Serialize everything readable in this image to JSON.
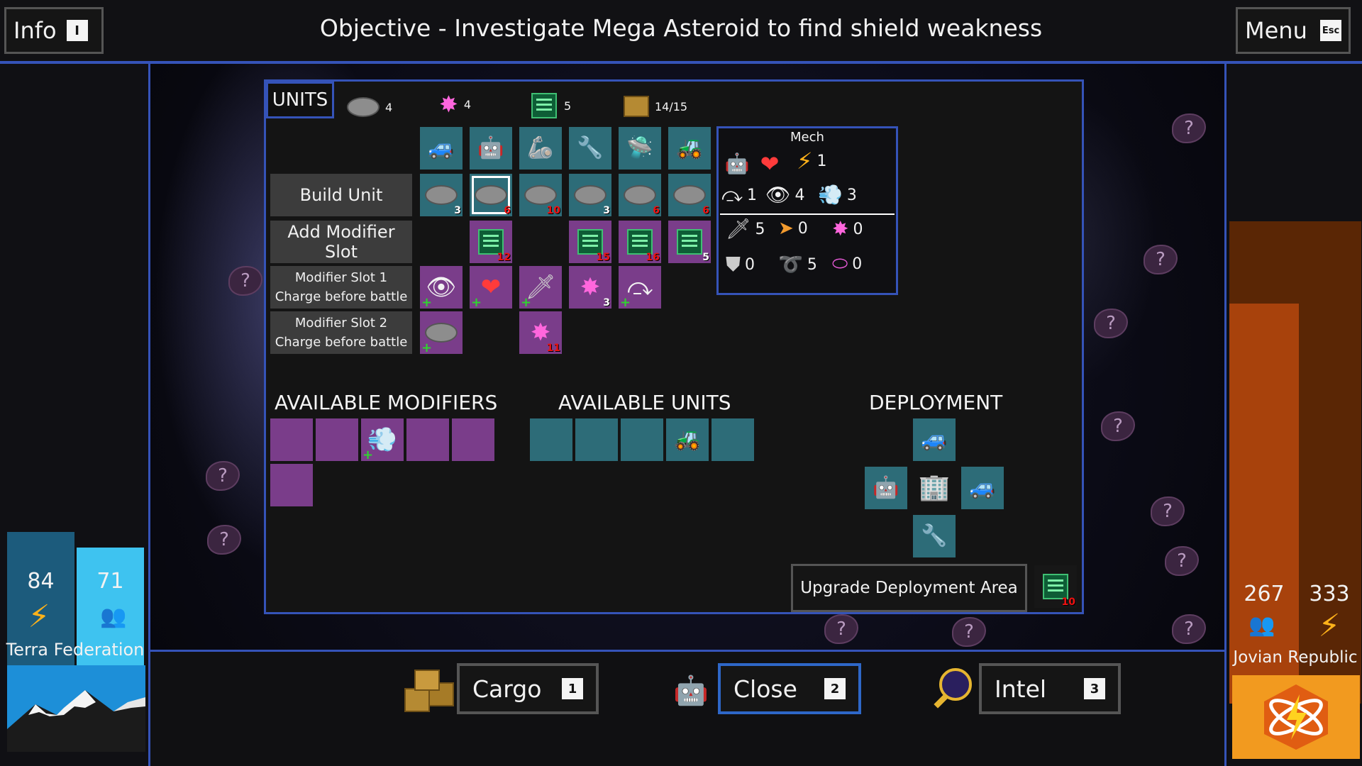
{
  "top": {
    "info_label": "Info",
    "info_key": "I",
    "objective_label": "Objective -",
    "objective_text": "Investigate Mega Asteroid to find shield weakness",
    "menu_label": "Menu",
    "menu_key": "Esc"
  },
  "left_faction": {
    "energy": "84",
    "population": "71",
    "name": "Terra Federation"
  },
  "right_faction": {
    "population": "267",
    "energy": "333",
    "name": "Jovian Republic"
  },
  "units_panel": {
    "tab_label": "UNITS",
    "resources": [
      {
        "icon": "rock-icon",
        "value": "4"
      },
      {
        "icon": "crystal-icon",
        "value": "4"
      },
      {
        "icon": "circuit-icon",
        "value": "5"
      },
      {
        "icon": "cargo-crate-icon",
        "value": "14/15"
      }
    ],
    "row_labels": {
      "build_unit": "Build Unit",
      "add_modifier_slot": "Add Modifier Slot",
      "modifier_slot_1_title": "Modifier Slot 1",
      "modifier_slot_1_sub": "Charge before battle",
      "modifier_slot_2_title": "Modifier Slot 2",
      "modifier_slot_2_sub": "Charge before battle"
    },
    "build_costs": [
      "3",
      "6",
      "10",
      "3",
      "6",
      "6"
    ],
    "slot_costs": [
      "12",
      "15",
      "16",
      "5"
    ],
    "slot1_cost": "3",
    "slot2_cost": "11",
    "headings": {
      "available_modifiers": "AVAILABLE MODIFIERS",
      "available_units": "AVAILABLE UNITS",
      "deployment": "DEPLOYMENT"
    },
    "upgrade_label": "Upgrade Deployment Area",
    "upgrade_cost": "10"
  },
  "mech_stats": {
    "title": "Mech",
    "energy": "1",
    "jump": "1",
    "vision": "4",
    "speed": "3",
    "attack": "5",
    "ranged": "0",
    "crystal": "0",
    "shield": "0",
    "missile": "5",
    "portal": "0"
  },
  "bottom": {
    "cargo_label": "Cargo",
    "cargo_key": "1",
    "close_label": "Close",
    "close_key": "2",
    "intel_label": "Intel",
    "intel_key": "3"
  },
  "colors": {
    "accent_blue": "#3553b8",
    "teal_tile": "#2d6c78",
    "purple_tile": "#7a3d8a",
    "terra_blue": "#1a9fd8",
    "jovian_orange": "#d8701c"
  }
}
